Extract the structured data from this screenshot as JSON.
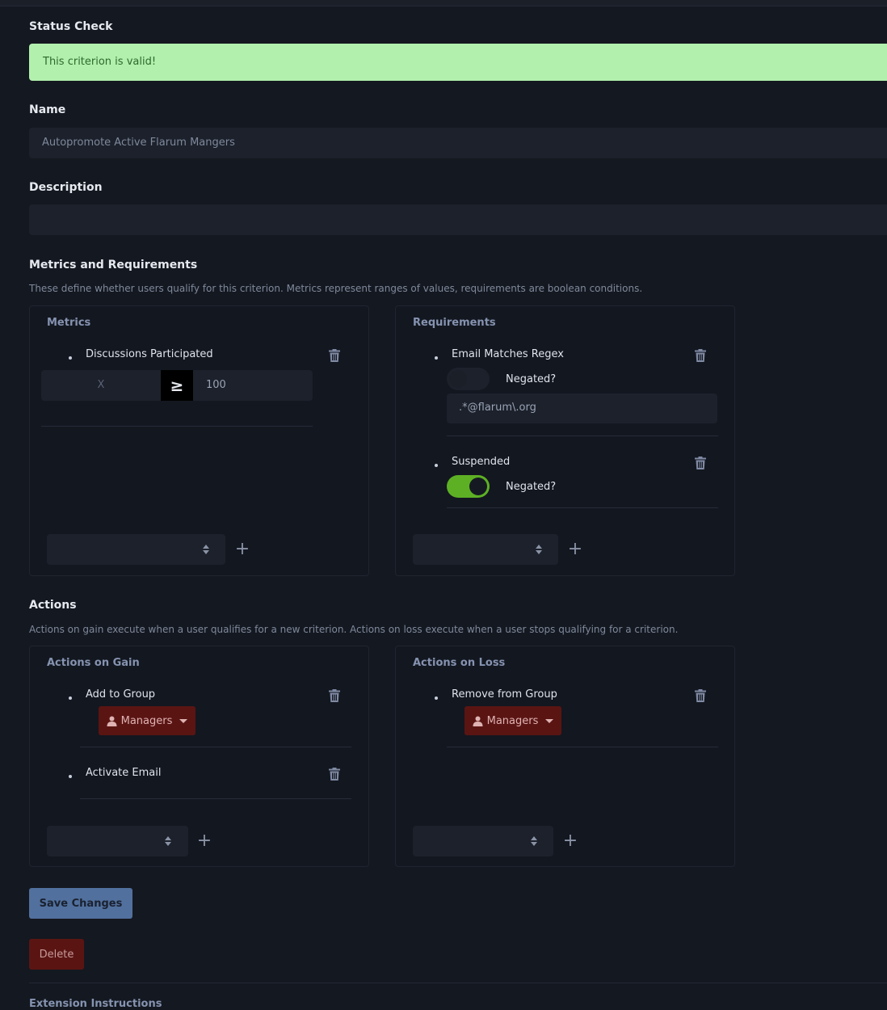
{
  "status_check": {
    "label": "Status Check",
    "message": "This criterion is valid!"
  },
  "name": {
    "label": "Name",
    "value": "Autopromote Active Flarum Mangers"
  },
  "description": {
    "label": "Description",
    "value": ""
  },
  "metrics_requirements": {
    "label": "Metrics and Requirements",
    "help": "These define whether users qualify for this criterion. Metrics represent ranges of values, requirements are boolean conditions.",
    "metrics": {
      "title": "Metrics",
      "items": [
        {
          "label": "Discussions Participated",
          "min": "X",
          "operator": "≥",
          "max": "100"
        }
      ]
    },
    "requirements": {
      "title": "Requirements",
      "items": [
        {
          "label": "Email Matches Regex",
          "negated_label": "Negated?",
          "negated": false,
          "value": ".*@flarum\\.org"
        },
        {
          "label": "Suspended",
          "negated_label": "Negated?",
          "negated": true
        }
      ]
    }
  },
  "actions": {
    "label": "Actions",
    "help": "Actions on gain execute when a user qualifies for a new criterion. Actions on loss execute when a user stops qualifying for a criterion.",
    "gain": {
      "title": "Actions on Gain",
      "items": [
        {
          "label": "Add to Group",
          "group": "Managers"
        },
        {
          "label": "Activate Email"
        }
      ]
    },
    "loss": {
      "title": "Actions on Loss",
      "items": [
        {
          "label": "Remove from Group",
          "group": "Managers"
        }
      ]
    }
  },
  "buttons": {
    "save": "Save Changes",
    "delete": "Delete",
    "add": "+"
  },
  "extension_instructions": {
    "title": "Extension Instructions"
  },
  "colors": {
    "background": "#141820",
    "success": "#b2f0ae",
    "toggle_on": "#5db024",
    "danger": "#5a1513",
    "primary": "#51709d"
  },
  "icons": [
    "trash-icon",
    "user-icon",
    "caret-down-icon",
    "sort-icon",
    "plus-icon"
  ]
}
